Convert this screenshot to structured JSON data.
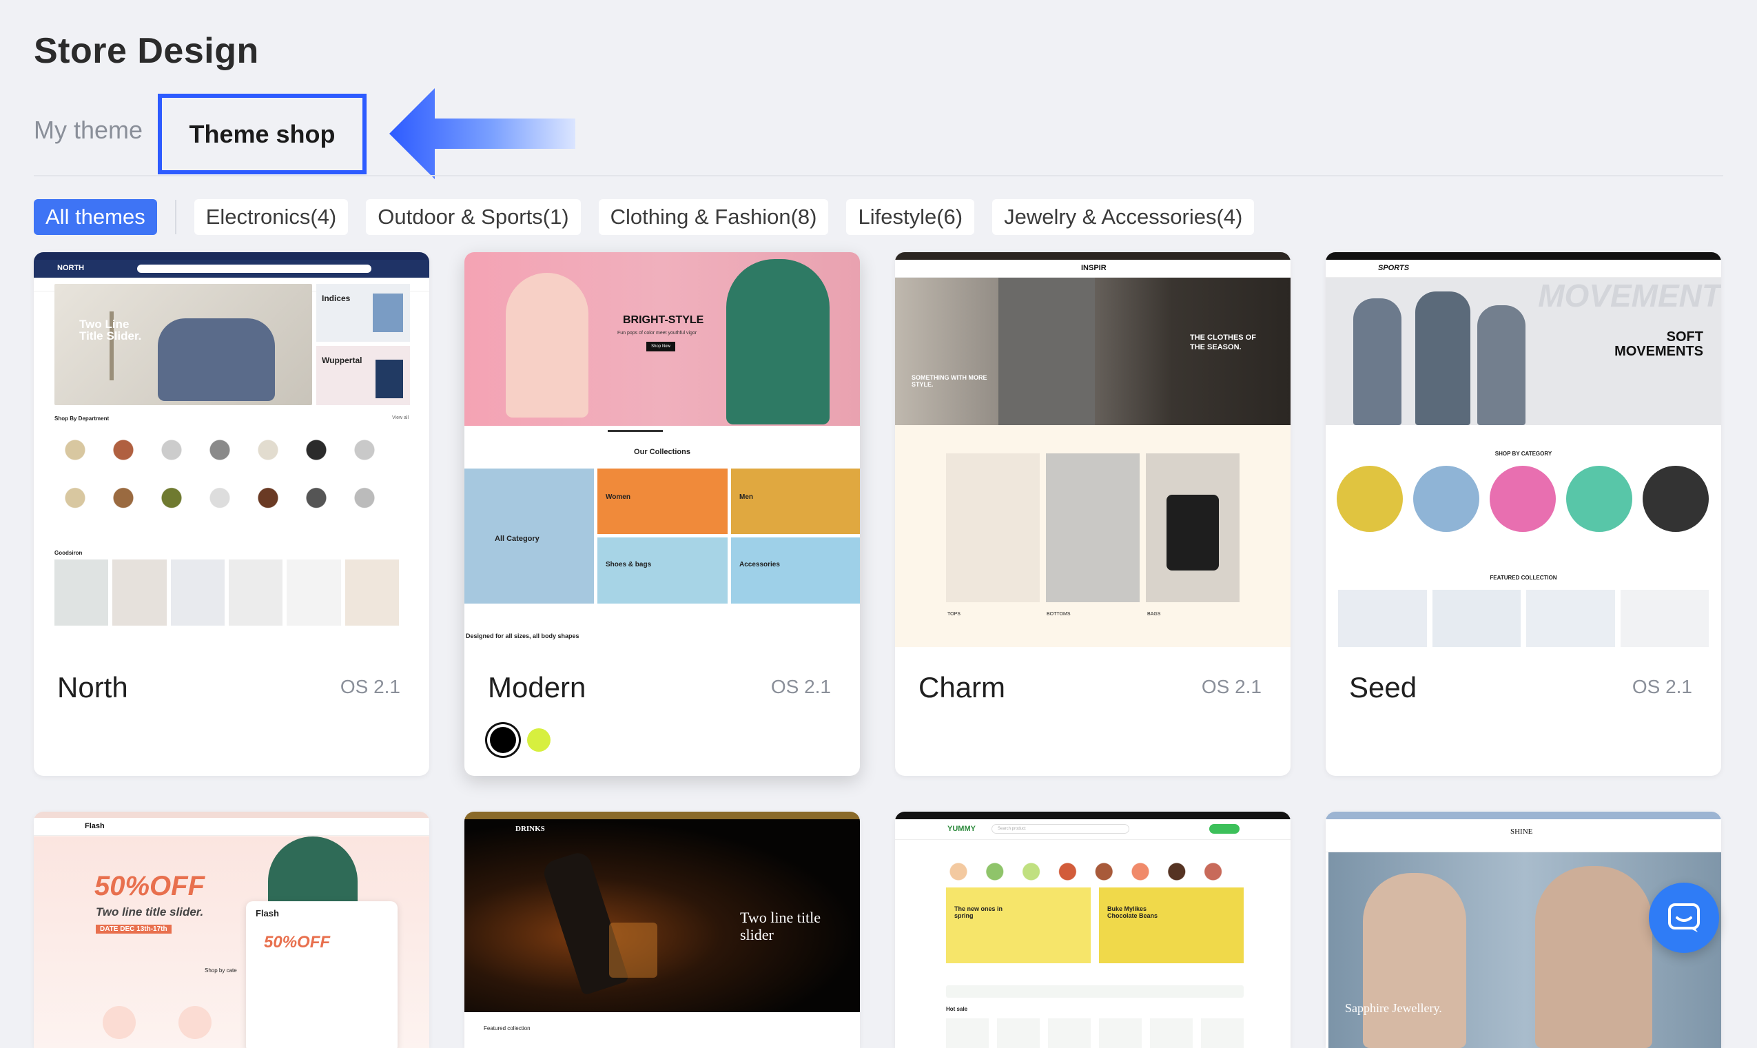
{
  "page": {
    "title": "Store Design"
  },
  "tabs": {
    "my_theme": "My theme",
    "theme_shop": "Theme shop"
  },
  "filters": [
    {
      "label": "All themes",
      "active": true
    },
    {
      "label": "Electronics(4)"
    },
    {
      "label": "Outdoor & Sports(1)"
    },
    {
      "label": "Clothing & Fashion(8)"
    },
    {
      "label": "Lifestyle(6)"
    },
    {
      "label": "Jewelry & Accessories(4)"
    }
  ],
  "themes": [
    {
      "name": "North",
      "version": "OS 2.1"
    },
    {
      "name": "Modern",
      "version": "OS 2.1",
      "colors": [
        "#000000",
        "#d7ef3f"
      ]
    },
    {
      "name": "Charm",
      "version": "OS 2.1"
    },
    {
      "name": "Seed",
      "version": "OS 2.1"
    }
  ],
  "previews": {
    "north": {
      "logo": "NORTH",
      "hero": "Two Line Title Slider.",
      "indices": "Indices",
      "wuppertal": "Wuppertal",
      "shop_by_dept": "Shop By Department",
      "view_all": "View all",
      "goodsiron": "Goodsiron"
    },
    "modern": {
      "hero": "BRIGHT-STYLE",
      "hero_sub": "Fun pops of color meet youthful vigor",
      "shop_now": "Shop Now",
      "collections": "Our Collections",
      "all_category": "All Category",
      "women": "Women",
      "men": "Men",
      "shoes": "Shoes & bags",
      "accessories": "Accessories",
      "footer": "Designed for all sizes, all body shapes"
    },
    "charm": {
      "logo": "INSPIR",
      "hero_left": "SOMETHING WITH MORE STYLE.",
      "hero_right": "THE CLOTHES OF THE SEASON.",
      "tops": "TOPS",
      "bottoms": "BOTTOMS",
      "bags": "BAGS"
    },
    "seed": {
      "logo": "SPORTS",
      "bg_word": "MOVEMENT",
      "hero": "SOFT MOVEMENTS",
      "shop_by_category": "SHOP BY CATEGORY",
      "featured": "FEATURED COLLECTION"
    },
    "flash": {
      "logo": "Flash",
      "offer": "50%OFF",
      "sub": "Two line title slider.",
      "date": "DATE  DEC 13th-17th",
      "shop_by_cate": "Shop by cate"
    },
    "drinks": {
      "logo": "DRINKS",
      "hero": "Two line title slider",
      "featured": "Featured collection"
    },
    "yummy": {
      "logo": "YUMMY",
      "search": "Search product",
      "card1": "The new ones in spring",
      "card2": "Buke Mylikes Chocolate Beans",
      "hot": "Hot sale"
    },
    "shine": {
      "logo": "SHINE",
      "hero": "Sapphire Jewellery."
    }
  },
  "icons": {
    "arrow": "left-arrow-icon",
    "chat": "chat-icon"
  }
}
